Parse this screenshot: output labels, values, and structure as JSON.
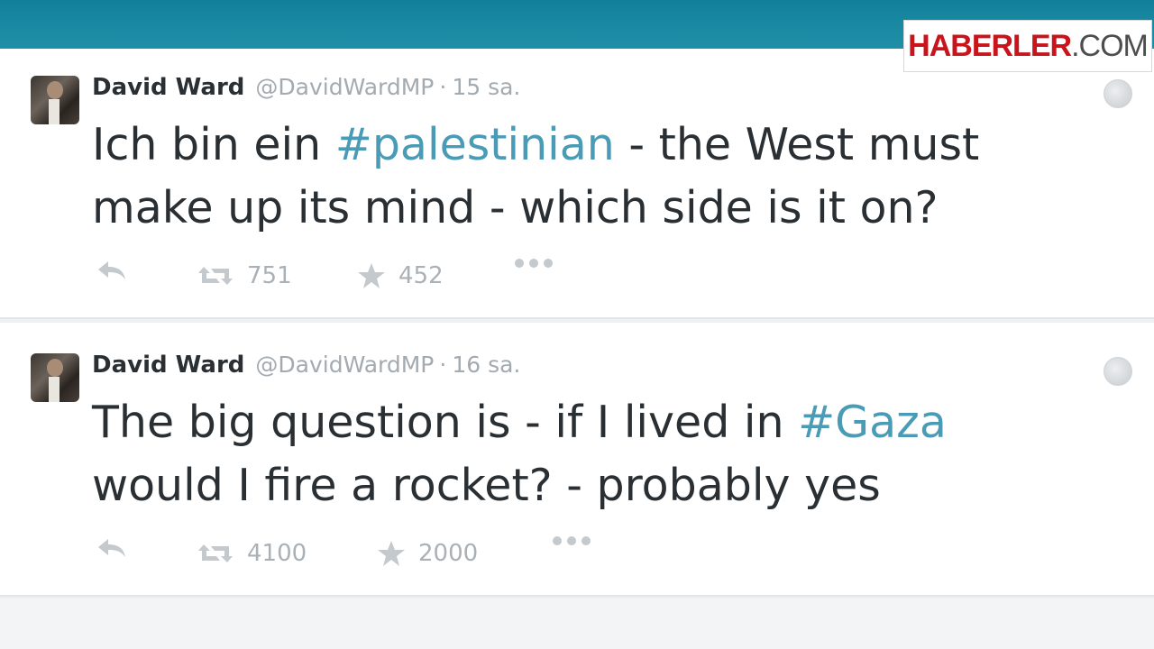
{
  "logo": {
    "part1": "HABERLER",
    "part2": ".COM"
  },
  "tweets": [
    {
      "author": "David Ward",
      "handle": "@DavidWardMP",
      "separator": "·",
      "time": "15 sa.",
      "text_before": "Ich bin ein ",
      "hashtag": "#palestinian",
      "text_after": " - the West must make up its mind - which side is it on?",
      "retweets": "751",
      "favorites": "452"
    },
    {
      "author": "David Ward",
      "handle": "@DavidWardMP",
      "separator": "·",
      "time": "16 sa.",
      "text_before": "The big question is - if I lived in ",
      "hashtag": "#Gaza",
      "text_after": " would I fire a rocket? - probably yes",
      "retweets": "4100",
      "favorites": "2000"
    }
  ],
  "icons": {
    "reply": "reply-icon",
    "retweet": "retweet-icon",
    "favorite": "star-icon",
    "more": "more-icon",
    "globe": "globe-icon"
  },
  "colors": {
    "topbar": "#1a8aa3",
    "hashtag": "#4a9cb6",
    "logo_red": "#c9141b",
    "text": "#292f33",
    "meta": "#a3aab0"
  }
}
